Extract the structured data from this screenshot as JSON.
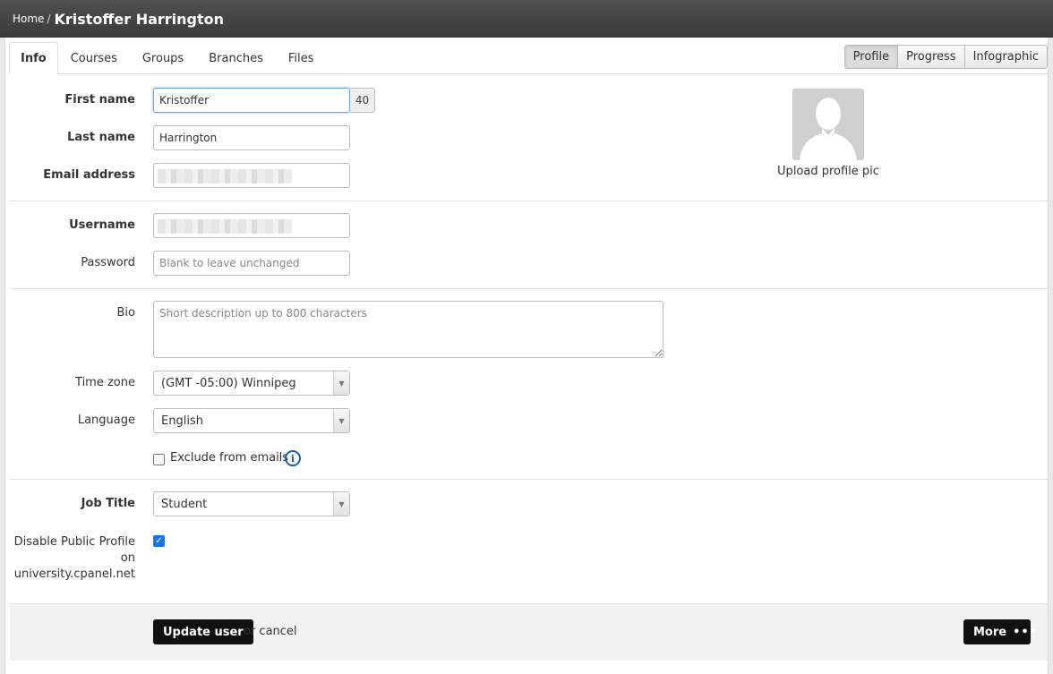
{
  "breadcrumb": {
    "home": "Home",
    "separator": "/",
    "current": "Kristoffer Harrington"
  },
  "tabs": [
    "Info",
    "Courses",
    "Groups",
    "Branches",
    "Files"
  ],
  "views": [
    "Profile",
    "Progress",
    "Infographic"
  ],
  "form": {
    "first_name": {
      "label": "First name",
      "value": "Kristoffer",
      "counter": "40"
    },
    "last_name": {
      "label": "Last name",
      "value": "Harrington"
    },
    "email": {
      "label": "Email address"
    },
    "username": {
      "label": "Username"
    },
    "password": {
      "label": "Password",
      "placeholder": "Blank to leave unchanged"
    },
    "bio": {
      "label": "Bio",
      "placeholder": "Short description up to 800 characters"
    },
    "timezone": {
      "label": "Time zone",
      "value": "(GMT -05:00) Winnipeg"
    },
    "language": {
      "label": "Language",
      "value": "English"
    },
    "exclude_emails": {
      "label": "Exclude from emails",
      "checked": false
    },
    "job_title": {
      "label": "Job Title",
      "value": "Student"
    },
    "disable_public_profile": {
      "label_line1": "Disable Public Profile",
      "label_line2": "on",
      "label_line3": "university.cpanel.net",
      "checked": true
    }
  },
  "avatar": {
    "upload_label": "Upload profile pic"
  },
  "footer": {
    "update_label": "Update user",
    "cancel_text": "or cancel",
    "more_label": "More"
  }
}
